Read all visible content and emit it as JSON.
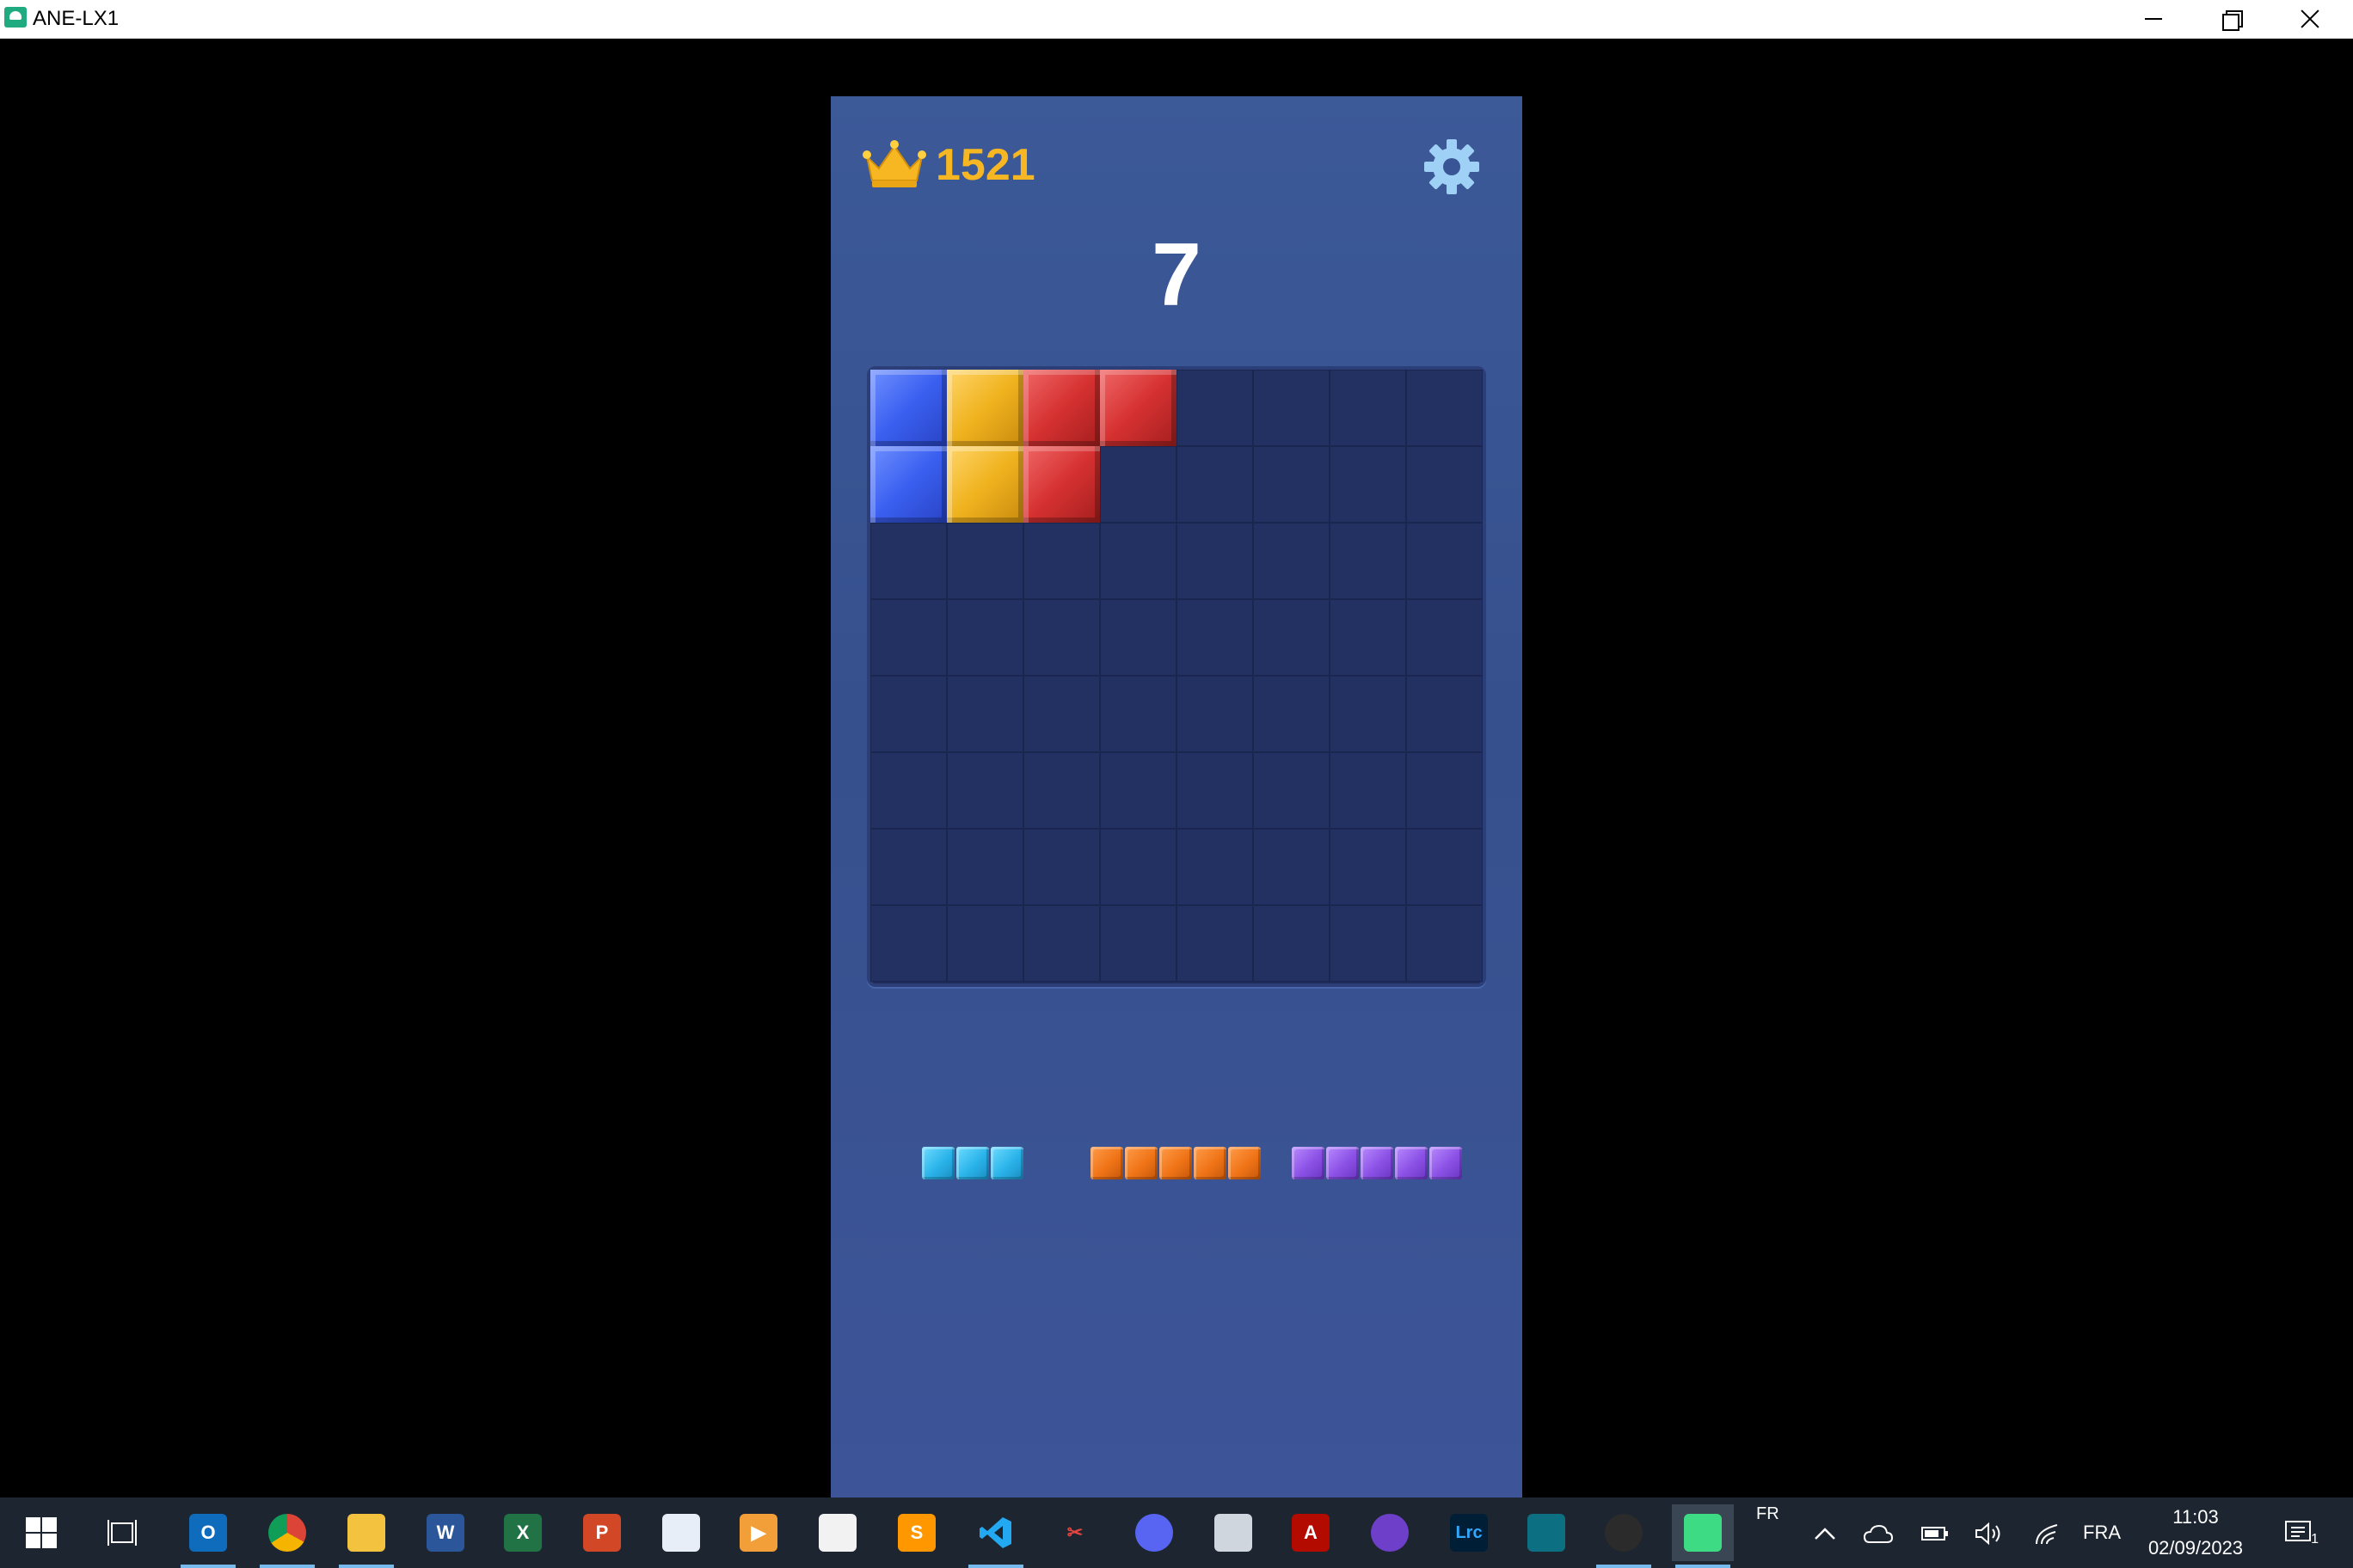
{
  "window": {
    "title": "ANE-LX1"
  },
  "game": {
    "best_score": "1521",
    "current_score": "7",
    "board_rows": 8,
    "board_cols": 8,
    "filled_cells": [
      {
        "row": 0,
        "col": 0,
        "color": "blue"
      },
      {
        "row": 0,
        "col": 1,
        "color": "yellow"
      },
      {
        "row": 0,
        "col": 2,
        "color": "red"
      },
      {
        "row": 0,
        "col": 3,
        "color": "red"
      },
      {
        "row": 1,
        "col": 0,
        "color": "blue"
      },
      {
        "row": 1,
        "col": 1,
        "color": "yellow"
      },
      {
        "row": 1,
        "col": 2,
        "color": "red"
      }
    ],
    "pieces": [
      {
        "length": 3,
        "orientation": "horizontal",
        "color": "cyan"
      },
      {
        "length": 5,
        "orientation": "horizontal",
        "color": "orange"
      },
      {
        "length": 5,
        "orientation": "horizontal",
        "color": "purple"
      }
    ],
    "colors": {
      "background": "#3c5998",
      "board": "#1f2c5a",
      "best_score": "#f6b722",
      "settings_icon": "#9fd0f5"
    }
  },
  "taskbar": {
    "apps": [
      "start-icon",
      "task-view-icon",
      "outlook-icon",
      "chrome-icon",
      "file-explorer-icon",
      "word-icon",
      "excel-icon",
      "powerpoint-icon",
      "paint-icon",
      "media-player-icon",
      "python-file-icon",
      "sublime-text-icon",
      "vscode-icon",
      "snipping-tool-icon",
      "discord-icon",
      "scanner-icon",
      "acrobat-icon",
      "github-desktop-icon",
      "lightroom-icon",
      "terminal-icon",
      "obs-icon",
      "android-emulator-icon"
    ],
    "lrc_label": "Lrc",
    "ime": "FR",
    "language": "FRA",
    "time": "11:03",
    "date": "02/09/2023",
    "notification_count": "1"
  }
}
